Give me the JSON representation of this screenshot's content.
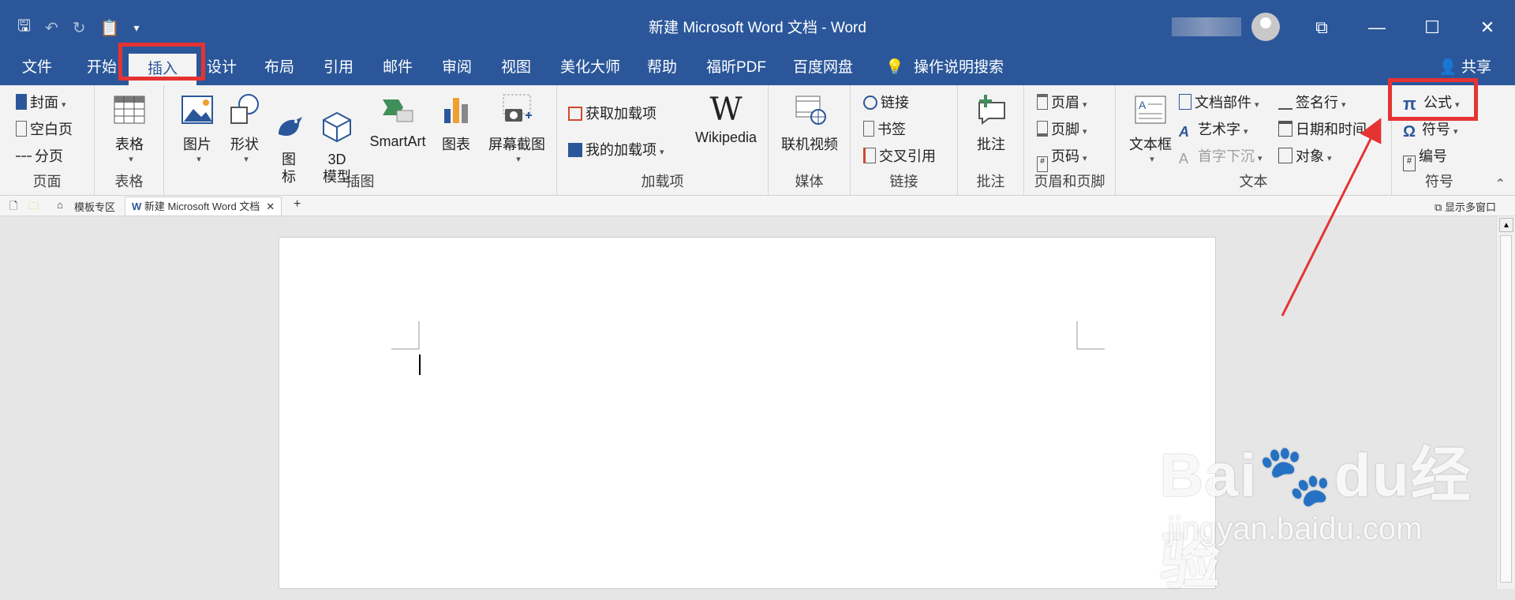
{
  "window": {
    "title": "新建 Microsoft Word 文档  -  Word"
  },
  "tabs": [
    {
      "label": "文件"
    },
    {
      "label": "开始"
    },
    {
      "label": "插入"
    },
    {
      "label": "设计"
    },
    {
      "label": "布局"
    },
    {
      "label": "引用"
    },
    {
      "label": "邮件"
    },
    {
      "label": "审阅"
    },
    {
      "label": "视图"
    },
    {
      "label": "美化大师"
    },
    {
      "label": "帮助"
    },
    {
      "label": "福昕PDF"
    },
    {
      "label": "百度网盘"
    },
    {
      "label": "操作说明搜索"
    }
  ],
  "share_label": "共享",
  "ribbon": {
    "pages": {
      "label": "页面",
      "cover": "封面",
      "blank": "空白页",
      "break": "分页"
    },
    "table": {
      "label": "表格",
      "btn": "表格"
    },
    "illustrations": {
      "label": "插图",
      "picture": "图片",
      "shapes": "形状",
      "icons": "图\n标",
      "model": "3D\n模型",
      "smartart": "SmartArt",
      "chart": "图表",
      "screenshot": "屏幕截图"
    },
    "addins": {
      "label": "加载项",
      "get": "获取加载项",
      "my": "我的加载项",
      "wiki": "Wikipedia"
    },
    "media": {
      "label": "媒体",
      "video": "联机视频"
    },
    "links": {
      "label": "链接",
      "link": "链接",
      "bookmark": "书签",
      "xref": "交叉引用"
    },
    "comments": {
      "label": "批注",
      "comment": "批注"
    },
    "headerfooter": {
      "label": "页眉和页脚",
      "header": "页眉",
      "footer": "页脚",
      "pagenum": "页码"
    },
    "text": {
      "label": "文本",
      "textbox": "文本框",
      "parts": "文档部件",
      "wordart": "艺术字",
      "dropcap": "首字下沉",
      "sigline": "签名行",
      "datetime": "日期和时间",
      "object": "对象"
    },
    "symbols": {
      "label": "符号",
      "equation": "公式",
      "symbol": "符号",
      "number": "编号"
    }
  },
  "doctabs": {
    "templates": "模板专区",
    "doc": "新建 Microsoft Word 文档",
    "multi": "显示多窗口"
  },
  "watermark": {
    "brand": "Bai",
    "brand2": "du",
    "cn": "经验",
    "url": "jingyan.baidu.com"
  },
  "colors": {
    "accent": "#2b579a",
    "highlight": "#e53333"
  }
}
